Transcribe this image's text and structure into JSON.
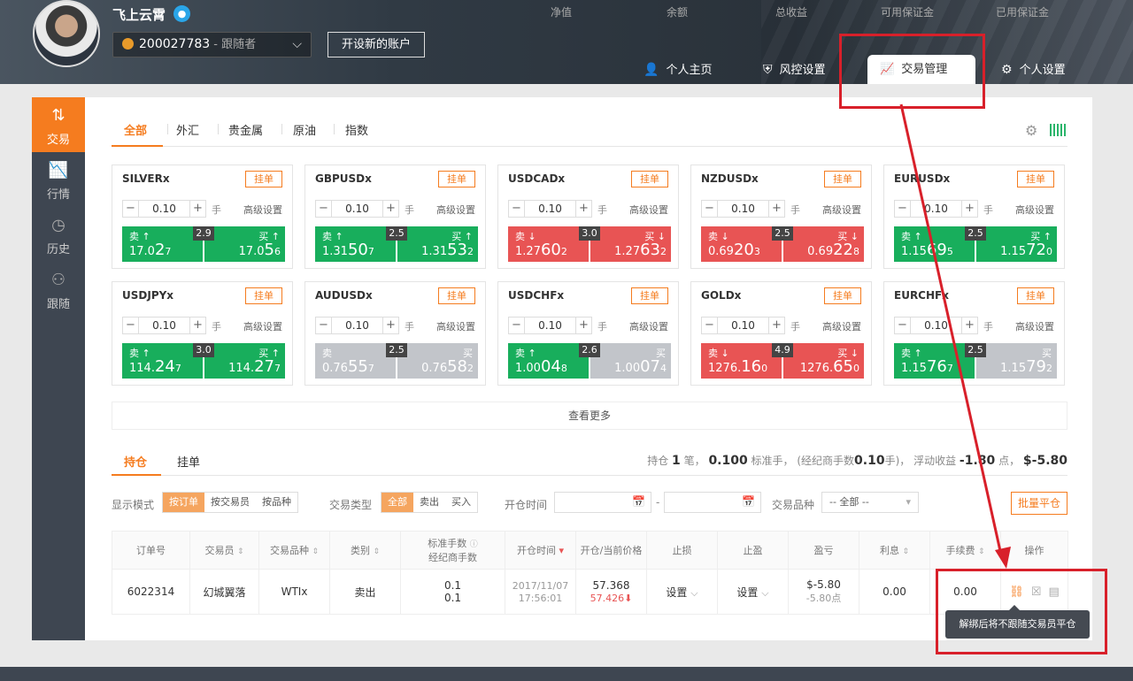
{
  "header": {
    "username": "飞上云霄",
    "account_id": "200027783",
    "account_role": " - 跟随者",
    "open_account": "开设新的账户",
    "stats": [
      "净值",
      "余额",
      "总收益",
      "可用保证金",
      "已用保证金"
    ],
    "nav": {
      "profile": "个人主页",
      "risk": "风控设置",
      "trade_mgmt": "交易管理",
      "settings": "个人设置"
    }
  },
  "sidebar": [
    "交易",
    "行情",
    "历史",
    "跟随"
  ],
  "tabs": [
    "全部",
    "外汇",
    "贵金属",
    "原油",
    "指数"
  ],
  "card_labels": {
    "order": "挂单",
    "unit": "手",
    "advanced": "高级设置",
    "sell": "卖",
    "buy": "买"
  },
  "cards": [
    {
      "symbol": "SILVERx",
      "qty": "0.10",
      "spread": "2.9",
      "sell_dir": "↑",
      "buy_dir": "↑",
      "sell_color": "green",
      "buy_color": "green",
      "sell_pre": "17.0",
      "sell_big": "2",
      "sell_sup": "7",
      "buy_pre": "17.0",
      "buy_big": "5",
      "buy_sup": "6"
    },
    {
      "symbol": "GBPUSDx",
      "qty": "0.10",
      "spread": "2.5",
      "sell_dir": "↑",
      "buy_dir": "↑",
      "sell_color": "green",
      "buy_color": "green",
      "sell_pre": "1.31",
      "sell_big": "50",
      "sell_sup": "7",
      "buy_pre": "1.31",
      "buy_big": "53",
      "buy_sup": "2"
    },
    {
      "symbol": "USDCADx",
      "qty": "0.10",
      "spread": "3.0",
      "sell_dir": "↓",
      "buy_dir": "↓",
      "sell_color": "red",
      "buy_color": "red",
      "sell_pre": "1.27",
      "sell_big": "60",
      "sell_sup": "2",
      "buy_pre": "1.27",
      "buy_big": "63",
      "buy_sup": "2"
    },
    {
      "symbol": "NZDUSDx",
      "qty": "0.10",
      "spread": "2.5",
      "sell_dir": "↓",
      "buy_dir": "↓",
      "sell_color": "red",
      "buy_color": "red",
      "sell_pre": "0.69",
      "sell_big": "20",
      "sell_sup": "3",
      "buy_pre": "0.69",
      "buy_big": "22",
      "buy_sup": "8"
    },
    {
      "symbol": "EURUSDx",
      "qty": "0.10",
      "spread": "2.5",
      "sell_dir": "↑",
      "buy_dir": "↑",
      "sell_color": "green",
      "buy_color": "green",
      "sell_pre": "1.15",
      "sell_big": "69",
      "sell_sup": "5",
      "buy_pre": "1.15",
      "buy_big": "72",
      "buy_sup": "0"
    },
    {
      "symbol": "USDJPYx",
      "qty": "0.10",
      "spread": "3.0",
      "sell_dir": "↑",
      "buy_dir": "↑",
      "sell_color": "green",
      "buy_color": "green",
      "sell_pre": "114.",
      "sell_big": "24",
      "sell_sup": "7",
      "buy_pre": "114.",
      "buy_big": "27",
      "buy_sup": "7"
    },
    {
      "symbol": "AUDUSDx",
      "qty": "0.10",
      "spread": "2.5",
      "sell_dir": "",
      "buy_dir": "",
      "sell_color": "gray",
      "buy_color": "gray",
      "sell_pre": "0.76",
      "sell_big": "55",
      "sell_sup": "7",
      "buy_pre": "0.76",
      "buy_big": "58",
      "buy_sup": "2"
    },
    {
      "symbol": "USDCHFx",
      "qty": "0.10",
      "spread": "2.6",
      "sell_dir": "↑",
      "buy_dir": "",
      "sell_color": "green",
      "buy_color": "gray",
      "sell_pre": "1.00",
      "sell_big": "04",
      "sell_sup": "8",
      "buy_pre": "1.00",
      "buy_big": "07",
      "buy_sup": "4"
    },
    {
      "symbol": "GOLDx",
      "qty": "0.10",
      "spread": "4.9",
      "sell_dir": "↓",
      "buy_dir": "↓",
      "sell_color": "red",
      "buy_color": "red",
      "sell_pre": "1276.",
      "sell_big": "16",
      "sell_sup": "0",
      "buy_pre": "1276.",
      "buy_big": "65",
      "buy_sup": "0"
    },
    {
      "symbol": "EURCHFx",
      "qty": "0.10",
      "spread": "2.5",
      "sell_dir": "↑",
      "buy_dir": "",
      "sell_color": "green",
      "buy_color": "gray",
      "sell_pre": "1.15",
      "sell_big": "76",
      "sell_sup": "7",
      "buy_pre": "1.15",
      "buy_big": "79",
      "buy_sup": "2"
    }
  ],
  "more": "查看更多",
  "positions": {
    "tabs": [
      "持仓",
      "挂单"
    ],
    "summary": {
      "p1": "持仓 ",
      "count": "1",
      "p2": " 笔， ",
      "lots": "0.100",
      "p3": " 标准手， (经纪商手数",
      "broker_lots": "0.10",
      "p4": "手)， 浮动收益 ",
      "points": "-1.80",
      "p5": " 点， ",
      "profit": "$-5.80"
    },
    "filters": {
      "mode_label": "显示模式",
      "mode_options": [
        "按订单",
        "按交易员",
        "按品种"
      ],
      "type_label": "交易类型",
      "type_options": [
        "全部",
        "卖出",
        "买入"
      ],
      "time_label": "开仓时间",
      "dash": "-",
      "symbol_label": "交易品种",
      "symbol_value": "-- 全部 --",
      "batch_close": "批量平仓"
    },
    "columns": [
      "订单号",
      "交易员",
      "交易品种",
      "类别",
      "标准手数",
      "经纪商手数",
      "开仓时间",
      "开仓/当前价格",
      "止损",
      "止盈",
      "盈亏",
      "利息",
      "手续费",
      "操作"
    ],
    "row": {
      "order_id": "6022314",
      "trader": "幻城翼落",
      "symbol": "WTIx",
      "side": "卖出",
      "std_lots": "0.1",
      "broker_lots": "0.1",
      "open_date": "2017/11/07",
      "open_time": "17:56:01",
      "open_price": "57.368",
      "current_price": "57.426",
      "stop_loss": "设置",
      "take_profit": "设置",
      "pnl": "$-5.80",
      "pnl_points": "-5.80点",
      "interest": "0.00",
      "fee": "0.00"
    }
  },
  "tooltip": "解绑后将不跟随交易员平仓",
  "colors": {
    "accent": "#f57c1f",
    "up": "#18ae5c",
    "down": "#e85454",
    "neutral": "#c2c5ca",
    "highlight": "#d8202a"
  }
}
